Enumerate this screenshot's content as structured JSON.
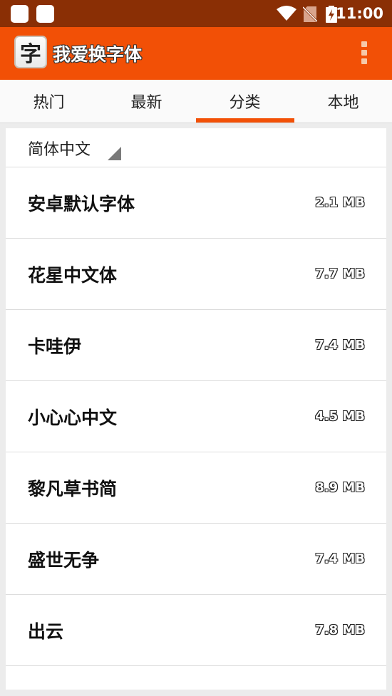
{
  "status_bar": {
    "time": "11:00",
    "icons": [
      "app-notification-icon",
      "app-notification-icon",
      "wifi-icon",
      "no-sim-icon",
      "battery-charging-icon"
    ]
  },
  "app_bar": {
    "logo_char": "字",
    "title": "我爱换字体",
    "menu_icon": "overflow-menu-icon"
  },
  "tabs": [
    {
      "label": "热门",
      "selected": false
    },
    {
      "label": "最新",
      "selected": false
    },
    {
      "label": "分类",
      "selected": true
    },
    {
      "label": "本地",
      "selected": false
    }
  ],
  "filter": {
    "selected_value": "简体中文"
  },
  "fonts": [
    {
      "name": "安卓默认字体",
      "size": "2.1 MB"
    },
    {
      "name": "花星中文体",
      "size": "7.7 MB"
    },
    {
      "name": "卡哇伊",
      "size": "7.4 MB"
    },
    {
      "name": "小心心中文",
      "size": "4.5 MB"
    },
    {
      "name": "黎凡草书简",
      "size": "8.9 MB"
    },
    {
      "name": "盛世无争",
      "size": "7.4 MB"
    },
    {
      "name": "出云",
      "size": "7.8 MB"
    }
  ],
  "colors": {
    "status_bar": "#8a2f05",
    "accent": "#f25006",
    "background": "#ececec"
  }
}
